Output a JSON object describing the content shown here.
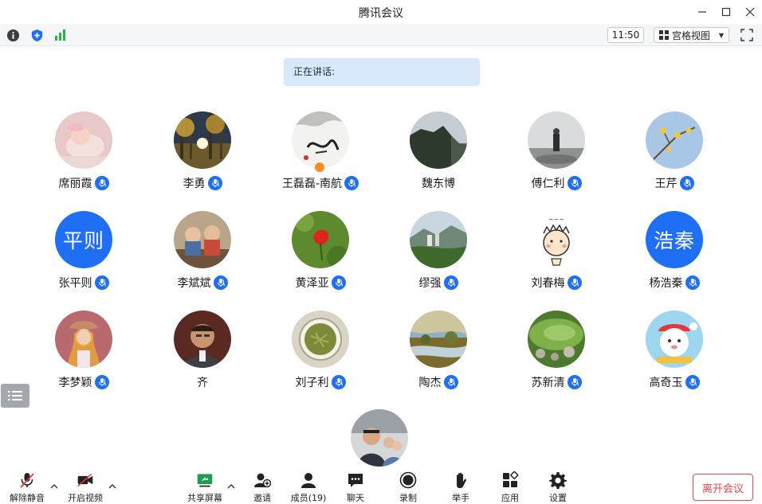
{
  "window": {
    "title": "腾讯会议"
  },
  "toolbar": {
    "time": "11:50",
    "view_label": "宫格视图"
  },
  "speaking": {
    "label": "正在讲话:"
  },
  "participants": [
    {
      "name": "席丽霞"
    },
    {
      "name": "李勇"
    },
    {
      "name": "王磊磊-南航"
    },
    {
      "name": "魏东博"
    },
    {
      "name": "傅仁利"
    },
    {
      "name": "王芹"
    },
    {
      "name": "张平则",
      "initials": "平则"
    },
    {
      "name": "李斌斌"
    },
    {
      "name": "黄泽亚"
    },
    {
      "name": "缪强"
    },
    {
      "name": "刘春梅"
    },
    {
      "name": "杨浩秦",
      "initials": "浩秦"
    },
    {
      "name": "李梦颖"
    },
    {
      "name": "齐"
    },
    {
      "name": "刘子利"
    },
    {
      "name": "陶杰"
    },
    {
      "name": "苏新清"
    },
    {
      "name": "高奇玉"
    }
  ],
  "bottombar": {
    "unmute": "解除静音",
    "start_video": "开启视频",
    "share_screen": "共享屏幕",
    "invite": "邀请",
    "members": "成员(19)",
    "chat": "聊天",
    "record": "录制",
    "raise_hand": "举手",
    "apps": "应用",
    "settings": "设置",
    "leave": "离开会议"
  },
  "colors": {
    "accent": "#1e6ff5",
    "leave": "#e8474c",
    "speaking_bg": "#d9e8fb"
  }
}
